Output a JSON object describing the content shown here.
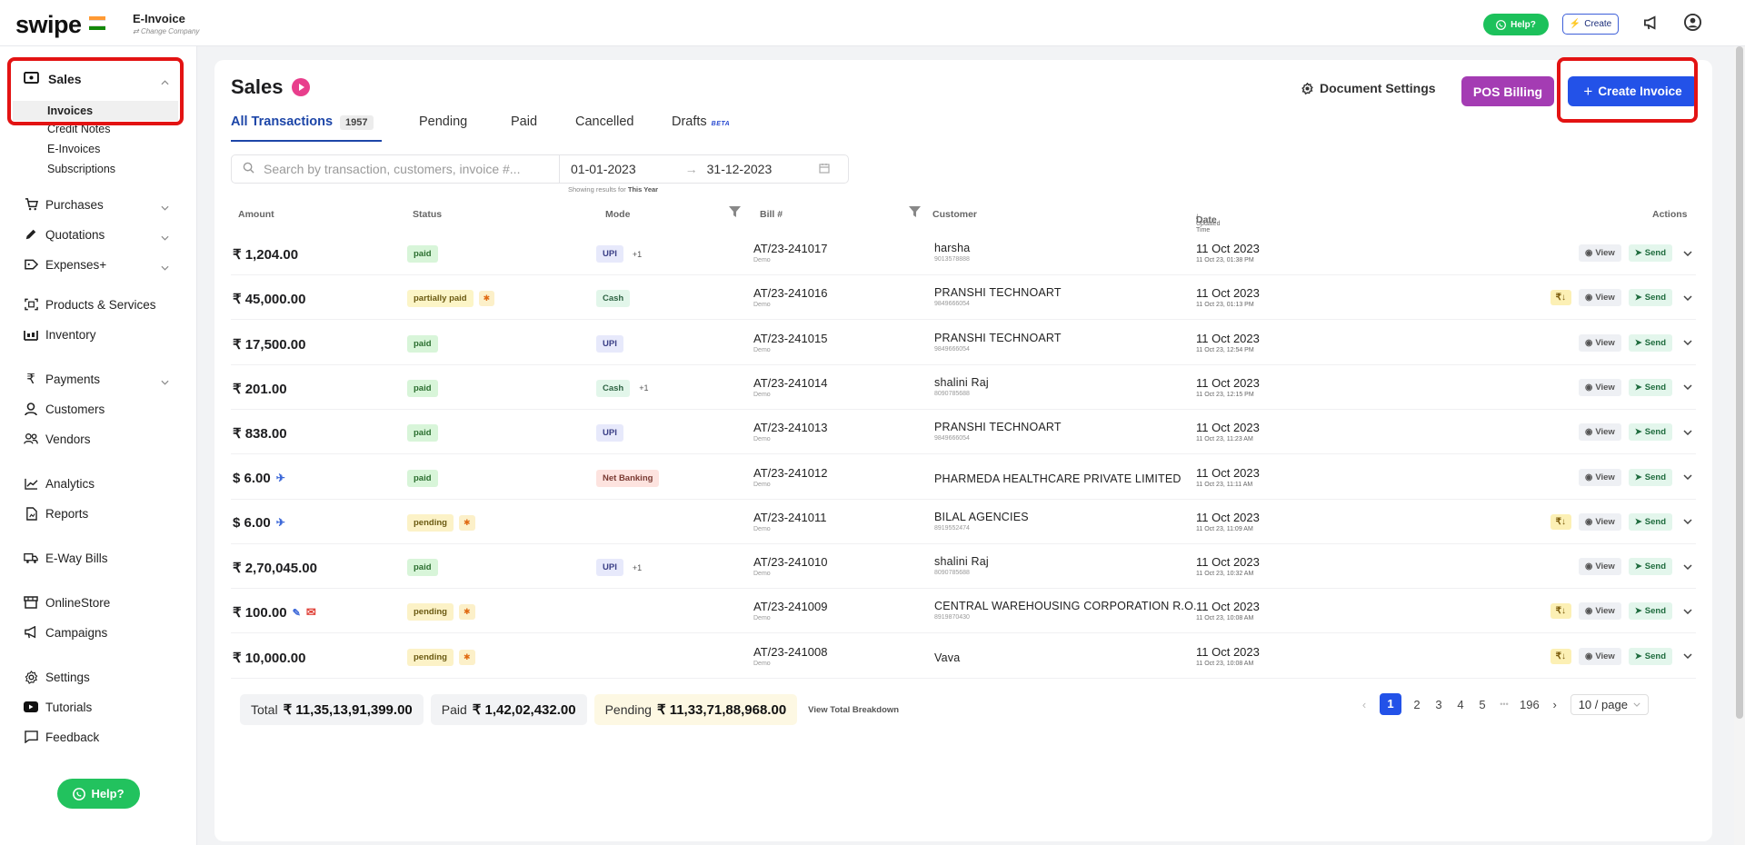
{
  "brand": {
    "logo": "swipe",
    "company_name": "E-Invoice",
    "change_company": "Change Company"
  },
  "topbar": {
    "help": "Help?",
    "create": "Create"
  },
  "sidebar": {
    "sales": "Sales",
    "sales_sub": [
      "Invoices",
      "Credit Notes",
      "E-Invoices",
      "Subscriptions"
    ],
    "items": [
      {
        "label": "Purchases",
        "icon": "cart-icon"
      },
      {
        "label": "Quotations",
        "icon": "pen-icon"
      },
      {
        "label": "Expenses+",
        "icon": "tag-icon"
      },
      {
        "label": "Products & Services",
        "icon": "product-icon"
      },
      {
        "label": "Inventory",
        "icon": "inventory-icon"
      },
      {
        "label": "Payments",
        "icon": "rupee-icon"
      },
      {
        "label": "Customers",
        "icon": "person-icon"
      },
      {
        "label": "Vendors",
        "icon": "people-icon"
      },
      {
        "label": "Analytics",
        "icon": "chart-icon"
      },
      {
        "label": "Reports",
        "icon": "report-icon"
      },
      {
        "label": "E-Way Bills",
        "icon": "truck-icon"
      },
      {
        "label": "OnlineStore",
        "icon": "store-icon"
      },
      {
        "label": "Campaigns",
        "icon": "megaphone-icon"
      },
      {
        "label": "Settings",
        "icon": "gear-icon"
      },
      {
        "label": "Tutorials",
        "icon": "youtube-icon"
      },
      {
        "label": "Feedback",
        "icon": "chat-icon"
      }
    ],
    "help": "Help?"
  },
  "page": {
    "title": "Sales",
    "document_settings": "Document Settings",
    "pos_billing": "POS Billing",
    "create_invoice": "Create Invoice",
    "tabs": [
      {
        "label": "All Transactions",
        "count": "1957"
      },
      {
        "label": "Pending"
      },
      {
        "label": "Paid"
      },
      {
        "label": "Cancelled"
      },
      {
        "label": "Drafts",
        "badge": "BETA"
      }
    ],
    "search_placeholder": "Search by transaction, customers, invoice #...",
    "date_from": "01-01-2023",
    "date_to": "31-12-2023",
    "date_note_prefix": "Showing results for",
    "date_note_value": "This Year"
  },
  "table": {
    "headers": {
      "amount": "Amount",
      "status": "Status",
      "mode": "Mode",
      "bill": "Bill #",
      "customer": "Customer",
      "date": "Date",
      "date_sub": "/ Updated Time",
      "actions": "Actions"
    },
    "view_label": "View",
    "send_label": "Send",
    "rows": [
      {
        "amount": "₹ 1,204.00",
        "status": "paid",
        "mode": "UPI",
        "mode_extra": "+1",
        "bill": "AT/23-241017",
        "bill_sub": "Demo",
        "customer": "harsha",
        "customer_sub": "9013578888",
        "date": "11 Oct 2023",
        "time": "11 Oct 23, 01:38 PM",
        "rupee": false
      },
      {
        "amount": "₹ 45,000.00",
        "status": "partially paid",
        "star": true,
        "mode": "Cash",
        "bill": "AT/23-241016",
        "bill_sub": "Demo",
        "customer": "PRANSHI TECHNOART",
        "customer_sub": "9849666054",
        "date": "11 Oct 2023",
        "time": "11 Oct 23, 01:13 PM",
        "rupee": true
      },
      {
        "amount": "₹ 17,500.00",
        "status": "paid",
        "mode": "UPI",
        "bill": "AT/23-241015",
        "bill_sub": "Demo",
        "customer": "PRANSHI TECHNOART",
        "customer_sub": "9849666054",
        "date": "11 Oct 2023",
        "time": "11 Oct 23, 12:54 PM",
        "rupee": false
      },
      {
        "amount": "₹ 201.00",
        "status": "paid",
        "mode": "Cash",
        "mode_extra": "+1",
        "bill": "AT/23-241014",
        "bill_sub": "Demo",
        "customer": "shalini Raj",
        "customer_sub": "8090785688",
        "date": "11 Oct 2023",
        "time": "11 Oct 23, 12:15 PM",
        "rupee": false
      },
      {
        "amount": "₹ 838.00",
        "status": "paid",
        "mode": "UPI",
        "bill": "AT/23-241013",
        "bill_sub": "Demo",
        "customer": "PRANSHI TECHNOART",
        "customer_sub": "9849666054",
        "date": "11 Oct 2023",
        "time": "11 Oct 23, 11:23 AM",
        "rupee": false
      },
      {
        "amount": "$ 6.00",
        "plane": true,
        "status": "paid",
        "mode": "Net Banking",
        "bill": "AT/23-241012",
        "bill_sub": "Demo",
        "customer": "PHARMEDA HEALTHCARE PRIVATE LIMITED",
        "date": "11 Oct 2023",
        "time": "11 Oct 23, 11:11 AM",
        "rupee": false
      },
      {
        "amount": "$ 6.00",
        "plane": true,
        "status": "pending",
        "star": true,
        "mode": "",
        "bill": "AT/23-241011",
        "bill_sub": "Demo",
        "customer": "BILAL AGENCIES",
        "customer_sub": "8919552474",
        "date": "11 Oct 2023",
        "time": "11 Oct 23, 11:09 AM",
        "rupee": true
      },
      {
        "amount": "₹ 2,70,045.00",
        "status": "paid",
        "mode": "UPI",
        "mode_extra": "+1",
        "bill": "AT/23-241010",
        "bill_sub": "Demo",
        "customer": "shalini Raj",
        "customer_sub": "8090785688",
        "date": "11 Oct 2023",
        "time": "11 Oct 23, 10:32 AM",
        "rupee": false
      },
      {
        "amount": "₹ 100.00",
        "tool": true,
        "status": "pending",
        "star": true,
        "mode": "",
        "bill": "AT/23-241009",
        "bill_sub": "Demo",
        "customer": "CENTRAL WAREHOUSING CORPORATION R.O.",
        "customer_sub": "8919870430",
        "date": "11 Oct 2023",
        "time": "11 Oct 23, 10:08 AM",
        "rupee": true
      },
      {
        "amount": "₹ 10,000.00",
        "status": "pending",
        "star": true,
        "mode": "",
        "bill": "AT/23-241008",
        "bill_sub": "Demo",
        "customer": "Vava",
        "date": "11 Oct 2023",
        "time": "11 Oct 23, 10:08 AM",
        "rupee": true
      }
    ]
  },
  "totals": {
    "total_label": "Total",
    "total_value": "₹ 11,35,13,91,399.00",
    "paid_label": "Paid",
    "paid_value": "₹ 1,42,02,432.00",
    "pending_label": "Pending",
    "pending_value": "₹ 11,33,71,88,968.00",
    "breakdown": "View Total Breakdown"
  },
  "pagination": {
    "pages": [
      "1",
      "2",
      "3",
      "4",
      "5"
    ],
    "ellipsis": "•••",
    "last": "196",
    "page_size": "10 / page",
    "current": "1"
  },
  "colors": {
    "primary": "#2352e8",
    "pos": "#a43cb3",
    "whatsapp": "#22c25e",
    "annotation": "#e31313"
  }
}
